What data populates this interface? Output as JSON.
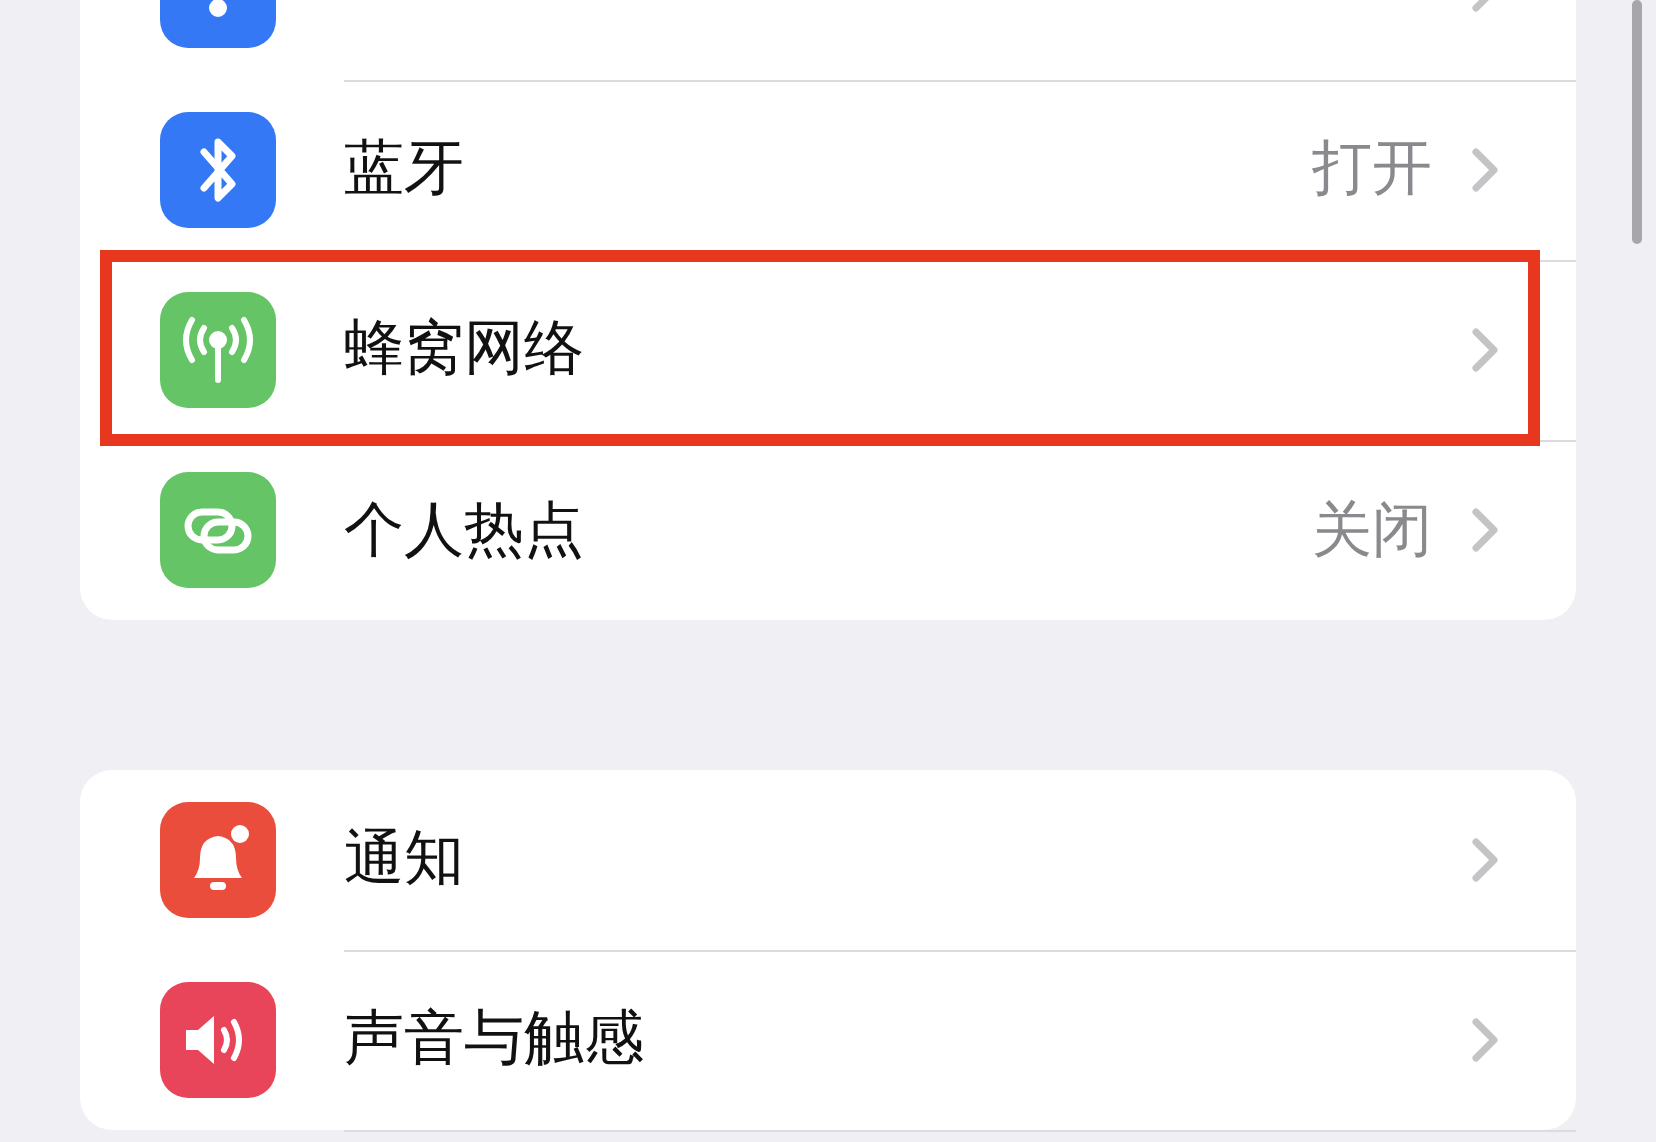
{
  "groups": [
    {
      "items": [
        {
          "kind": "wifi",
          "color": "#3478f6",
          "highlighted": false
        },
        {
          "kind": "bluetooth",
          "color": "#3478f6",
          "label": "蓝牙",
          "value": "打开",
          "highlighted": false
        },
        {
          "kind": "antenna",
          "color": "#65c466",
          "label": "蜂窝网络",
          "highlighted": true
        },
        {
          "kind": "link",
          "color": "#65c466",
          "label": "个人热点",
          "value": "关闭",
          "highlighted": false
        }
      ]
    },
    {
      "items": [
        {
          "kind": "bell",
          "color": "#eb4d3d",
          "label": "通知",
          "highlighted": false
        },
        {
          "kind": "speaker",
          "color": "#e9455a",
          "label": "声音与触感",
          "highlighted": false
        }
      ]
    }
  ]
}
